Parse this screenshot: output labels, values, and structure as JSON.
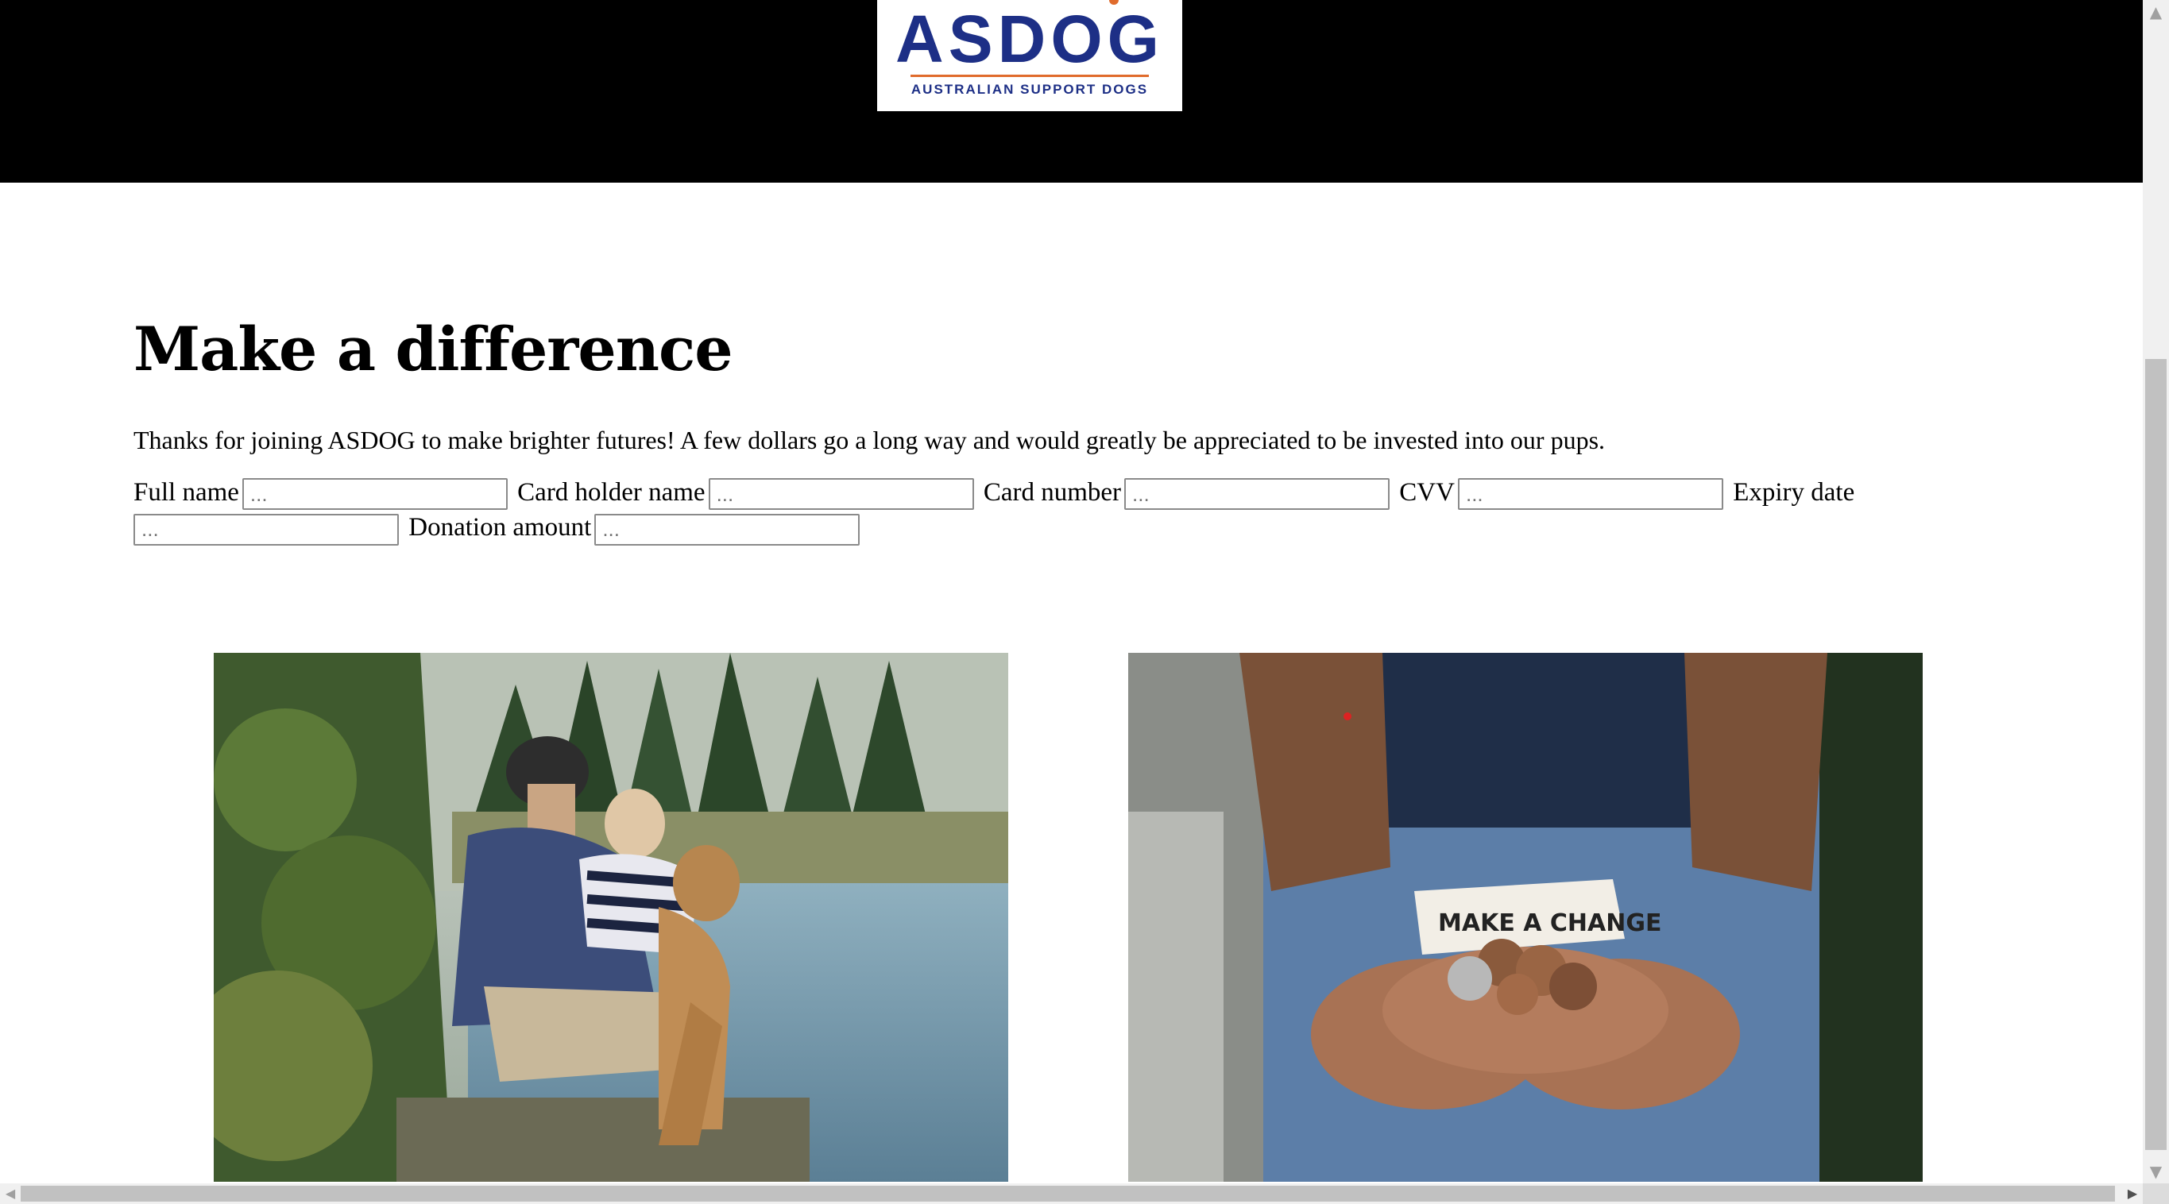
{
  "header": {
    "logo": {
      "mark": "ASDOG",
      "subtitle": "AUSTRALIAN SUPPORT DOGS"
    }
  },
  "main": {
    "title": "Make a difference",
    "intro": "Thanks for joining ASDOG to make brighter futures! A few dollars go a long way and would greatly be appreciated to be invested into our pups.",
    "form": {
      "full_name_label": "Full name",
      "full_name_placeholder": "...",
      "card_holder_label": "Card holder name",
      "card_holder_placeholder": "...",
      "card_number_label": "Card number",
      "card_number_placeholder": "...",
      "cvv_label": "CVV",
      "cvv_placeholder": "...",
      "expiry_label": "Expiry date",
      "expiry_placeholder": "...",
      "amount_label": "Donation amount",
      "amount_placeholder": "..."
    },
    "images": [
      {
        "name": "couple-with-dog-by-lake-photo"
      },
      {
        "name": "hands-holding-coins-photo",
        "note_text": "MAKE A CHANGE"
      }
    ]
  },
  "scrollbars": {
    "vertical_icon_up": "▲",
    "vertical_icon_down": "▼",
    "horizontal_icon_left": "◀",
    "horizontal_icon_right": "▶"
  },
  "colors": {
    "header_bg": "#000000",
    "logo_blue": "#1d2f86",
    "logo_orange": "#e06b2c"
  }
}
